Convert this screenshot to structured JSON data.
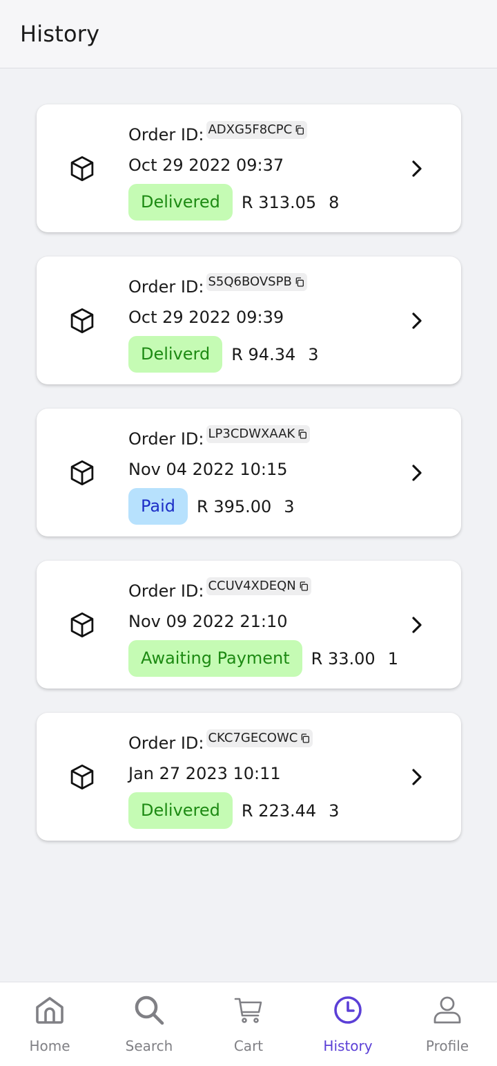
{
  "header": {
    "title": "History"
  },
  "orders": [
    {
      "label": "Order ID:",
      "id": "ADXG5F8CPC",
      "date": "Oct 29 2022 09:37",
      "status": "Delivered",
      "status_color": "green",
      "price": "R 313.05",
      "count": "8"
    },
    {
      "label": "Order ID:",
      "id": "S5Q6BOVSPB",
      "date": "Oct 29 2022 09:39",
      "status": "Deliverd",
      "status_color": "green",
      "price": "R 94.34",
      "count": "3"
    },
    {
      "label": "Order ID:",
      "id": "LP3CDWXAAK",
      "date": "Nov 04 2022 10:15",
      "status": "Paid",
      "status_color": "blue",
      "price": "R 395.00",
      "count": "3"
    },
    {
      "label": "Order ID:",
      "id": "CCUV4XDEQN",
      "date": "Nov 09 2022 21:10",
      "status": "Awaiting Payment",
      "status_color": "green",
      "price": "R 33.00",
      "count": "1"
    },
    {
      "label": "Order ID:",
      "id": "CKC7GECOWC",
      "date": "Jan 27 2023 10:11",
      "status": "Delivered",
      "status_color": "green",
      "price": "R 223.44",
      "count": "3"
    }
  ],
  "nav": [
    {
      "label": "Home",
      "icon": "home-icon",
      "active": false
    },
    {
      "label": "Search",
      "icon": "search-icon",
      "active": false
    },
    {
      "label": "Cart",
      "icon": "cart-icon",
      "active": false
    },
    {
      "label": "History",
      "icon": "clock-icon",
      "active": true
    },
    {
      "label": "Profile",
      "icon": "user-icon",
      "active": false
    }
  ],
  "colors": {
    "accent": "#5b3fd6",
    "nav_inactive": "#808085",
    "status_green_bg": "#c5fbb4",
    "status_green_text": "#1d8a13",
    "status_blue_bg": "#b7e1fd",
    "status_blue_text": "#1d2fc7"
  }
}
